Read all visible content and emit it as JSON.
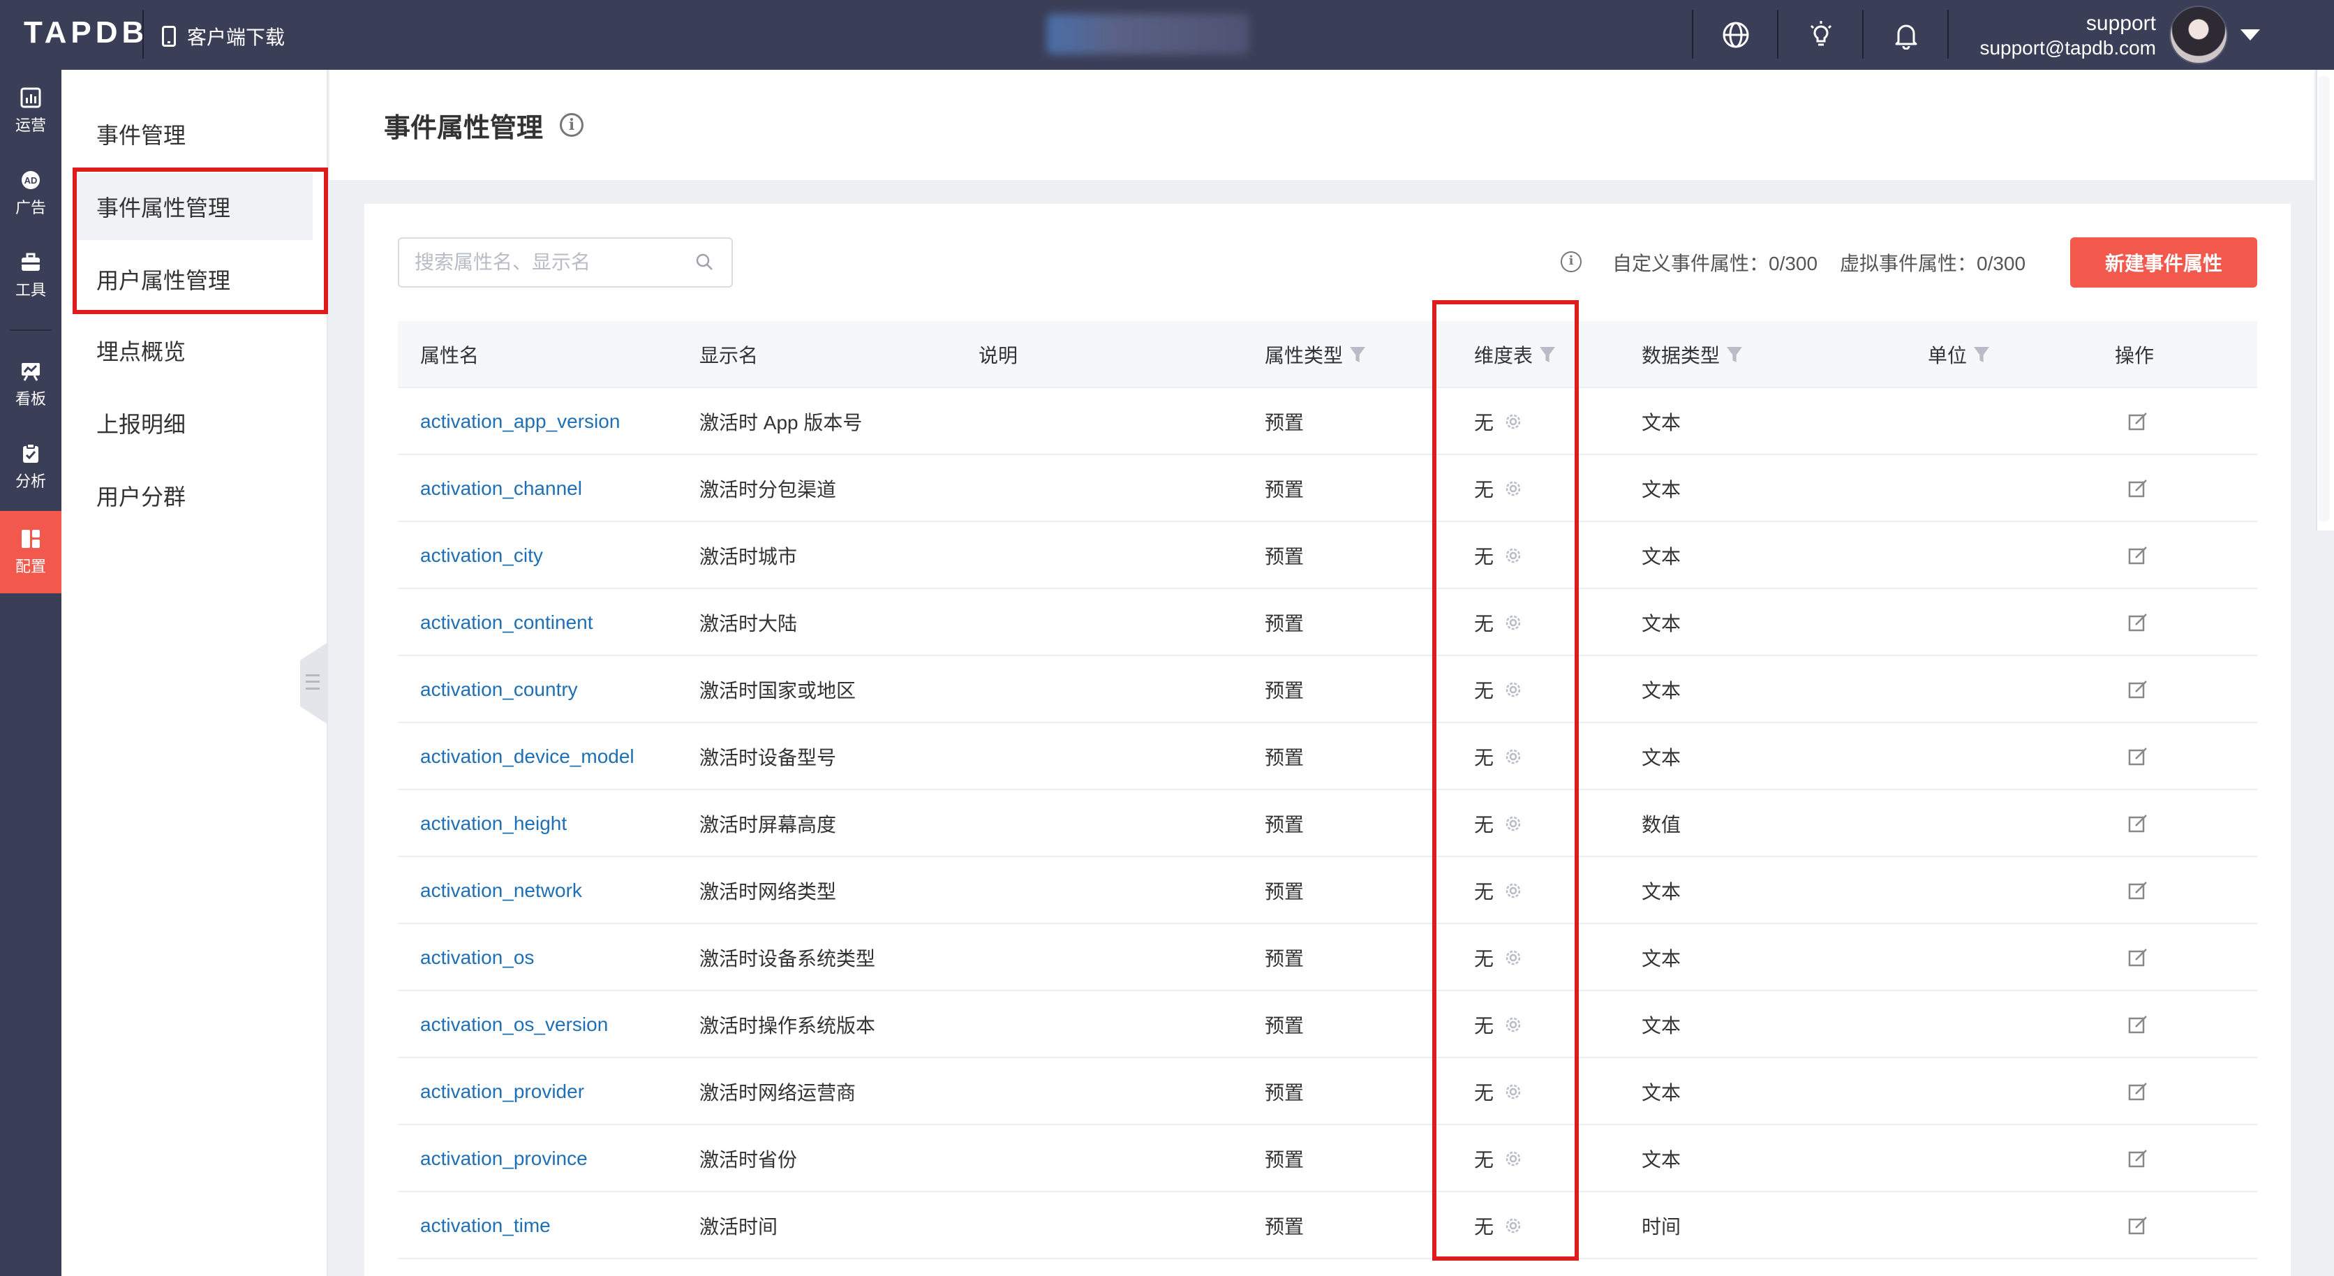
{
  "topbar": {
    "logo": "TAPDB",
    "download_label": "客户端下载",
    "user_name": "support",
    "user_email": "support@tapdb.com"
  },
  "rail": [
    {
      "label": "运营",
      "icon": "chart-icon"
    },
    {
      "label": "广告",
      "icon": "ad-icon"
    },
    {
      "label": "工具",
      "icon": "toolbox-icon"
    },
    {
      "label": "看板",
      "icon": "dashboard-icon"
    },
    {
      "label": "分析",
      "icon": "analysis-icon"
    },
    {
      "label": "配置",
      "icon": "config-icon",
      "active": true
    }
  ],
  "subnav": [
    {
      "label": "事件管理"
    },
    {
      "label": "事件属性管理",
      "active": true
    },
    {
      "label": "用户属性管理"
    },
    {
      "label": "埋点概览"
    },
    {
      "label": "上报明细"
    },
    {
      "label": "用户分群"
    }
  ],
  "page": {
    "title": "事件属性管理"
  },
  "toolbar": {
    "search_placeholder": "搜索属性名、显示名",
    "custom_quota": "自定义事件属性：0/300",
    "virtual_quota": "虚拟事件属性：0/300",
    "new_button": "新建事件属性"
  },
  "table": {
    "columns": [
      "属性名",
      "显示名",
      "说明",
      "属性类型",
      "维度表",
      "数据类型",
      "单位",
      "操作"
    ],
    "rows": [
      {
        "name": "activation_app_version",
        "display": "激活时 App 版本号",
        "desc": "",
        "prop_type": "预置",
        "dim_table": "无",
        "data_type": "文本",
        "unit": ""
      },
      {
        "name": "activation_channel",
        "display": "激活时分包渠道",
        "desc": "",
        "prop_type": "预置",
        "dim_table": "无",
        "data_type": "文本",
        "unit": ""
      },
      {
        "name": "activation_city",
        "display": "激活时城市",
        "desc": "",
        "prop_type": "预置",
        "dim_table": "无",
        "data_type": "文本",
        "unit": ""
      },
      {
        "name": "activation_continent",
        "display": "激活时大陆",
        "desc": "",
        "prop_type": "预置",
        "dim_table": "无",
        "data_type": "文本",
        "unit": ""
      },
      {
        "name": "activation_country",
        "display": "激活时国家或地区",
        "desc": "",
        "prop_type": "预置",
        "dim_table": "无",
        "data_type": "文本",
        "unit": ""
      },
      {
        "name": "activation_device_model",
        "display": "激活时设备型号",
        "desc": "",
        "prop_type": "预置",
        "dim_table": "无",
        "data_type": "文本",
        "unit": ""
      },
      {
        "name": "activation_height",
        "display": "激活时屏幕高度",
        "desc": "",
        "prop_type": "预置",
        "dim_table": "无",
        "data_type": "数值",
        "unit": ""
      },
      {
        "name": "activation_network",
        "display": "激活时网络类型",
        "desc": "",
        "prop_type": "预置",
        "dim_table": "无",
        "data_type": "文本",
        "unit": ""
      },
      {
        "name": "activation_os",
        "display": "激活时设备系统类型",
        "desc": "",
        "prop_type": "预置",
        "dim_table": "无",
        "data_type": "文本",
        "unit": ""
      },
      {
        "name": "activation_os_version",
        "display": "激活时操作系统版本",
        "desc": "",
        "prop_type": "预置",
        "dim_table": "无",
        "data_type": "文本",
        "unit": ""
      },
      {
        "name": "activation_provider",
        "display": "激活时网络运营商",
        "desc": "",
        "prop_type": "预置",
        "dim_table": "无",
        "data_type": "文本",
        "unit": ""
      },
      {
        "name": "activation_province",
        "display": "激活时省份",
        "desc": "",
        "prop_type": "预置",
        "dim_table": "无",
        "data_type": "文本",
        "unit": ""
      },
      {
        "name": "activation_time",
        "display": "激活时间",
        "desc": "",
        "prop_type": "预置",
        "dim_table": "无",
        "data_type": "时间",
        "unit": ""
      }
    ]
  },
  "colors": {
    "topbar": "#3b3e57",
    "accent": "#f2584b",
    "link": "#1f6fb5",
    "annotation": "#e01b1b"
  }
}
